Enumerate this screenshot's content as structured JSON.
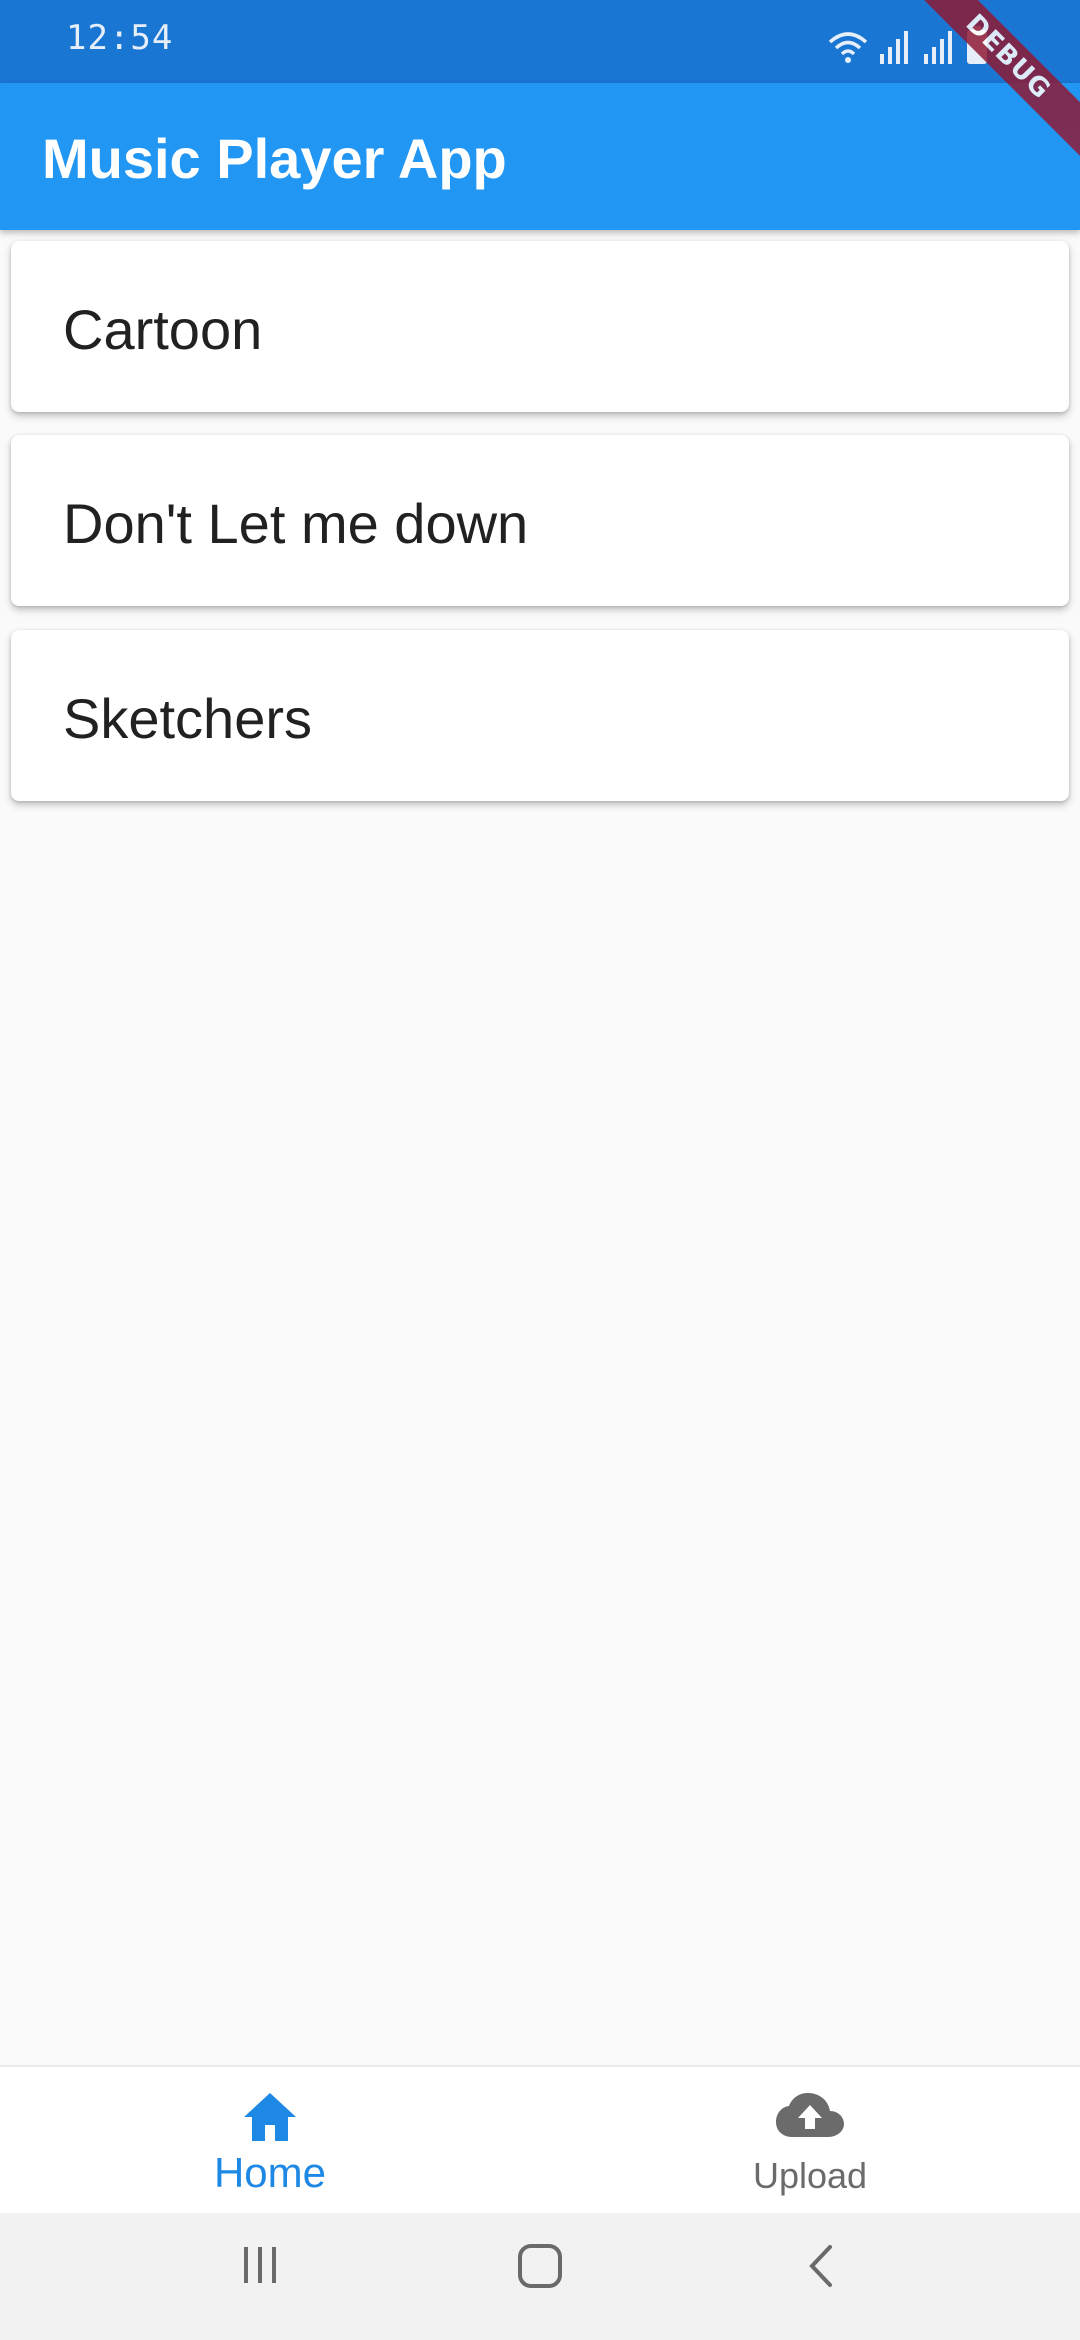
{
  "status_bar": {
    "time": "12:54",
    "icons": [
      "wifi-icon",
      "signal-icon",
      "signal-icon",
      "battery-icon"
    ]
  },
  "debug_banner": {
    "label": "DEBUG"
  },
  "app_bar": {
    "title": "Music Player App"
  },
  "songs": [
    {
      "title": "Cartoon"
    },
    {
      "title": "Don't Let me down"
    },
    {
      "title": "Sketchers"
    }
  ],
  "bottom_nav": {
    "items": [
      {
        "label": "Home",
        "icon": "home-icon",
        "selected": true
      },
      {
        "label": "Upload",
        "icon": "cloud-upload-icon",
        "selected": false
      }
    ]
  },
  "system_nav": {
    "buttons": [
      "recent-apps-icon",
      "home-circle-icon",
      "back-icon"
    ]
  },
  "colors": {
    "status_bar": "#1976d2",
    "app_bar": "#2196f3",
    "accent": "#1e88e5",
    "background": "#fafafa",
    "debug_banner": "#8e1b36"
  }
}
